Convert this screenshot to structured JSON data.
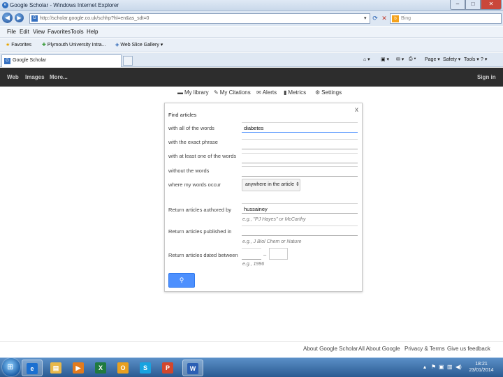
{
  "window": {
    "title": "Google Scholar - Windows Internet Explorer",
    "app_icon": "ie-icon"
  },
  "address_bar": {
    "url": "http://scholar.google.co.uk/schhp?hl=en&as_sdt=0",
    "search_placeholder": "Bing"
  },
  "menu": {
    "items": [
      "File",
      "Edit",
      "View",
      "Favorites",
      "Tools",
      "Help"
    ]
  },
  "favorites": {
    "favorites_label": "Favorites",
    "links": [
      "Plymouth University Intra...",
      "Web Slice Gallery ▾"
    ]
  },
  "tabs": {
    "active_label": "Google Scholar",
    "tools": [
      "Page ▾",
      "Safety ▾",
      "Tools ▾"
    ]
  },
  "google_bar": {
    "links": [
      "Web",
      "Images",
      "More..."
    ],
    "sign_in": "Sign in"
  },
  "scholar_nav": {
    "items": [
      "My library",
      "My Citations",
      "Alerts",
      "Metrics",
      "Settings"
    ]
  },
  "advanced_search": {
    "heading": "Find articles",
    "close": "x",
    "fields": {
      "all_words_label": "with all of the words",
      "all_words_value": "diabetes",
      "exact_phrase_label": "with the exact phrase",
      "at_least_one_label": "with at least one of the words",
      "without_label": "without the words",
      "where_label": "where my words occur",
      "where_value": "anywhere in the article",
      "author_label": "Return articles authored by",
      "author_value": "hussainey",
      "author_hint": "e.g., \"PJ Hayes\" or McCarthy",
      "published_label": "Return articles published in",
      "published_hint": "e.g., J Biol Chem or Nature",
      "dated_label": "Return articles dated between",
      "dated_hint": "e.g., 1996"
    },
    "search_button_icon": "search-icon"
  },
  "footer": {
    "links": [
      "About Google Scholar",
      "All About Google",
      "Privacy & Terms",
      "Give us feedback"
    ]
  },
  "taskbar": {
    "apps": [
      {
        "name": "internet-explorer",
        "glyph": "e",
        "color": "#1b6fd0"
      },
      {
        "name": "file-explorer",
        "glyph": "▤",
        "color": "#e8b84a"
      },
      {
        "name": "media-player",
        "glyph": "▶",
        "color": "#e27b1e"
      },
      {
        "name": "excel",
        "glyph": "X",
        "color": "#1f7a3f"
      },
      {
        "name": "outlook",
        "glyph": "O",
        "color": "#e8a020"
      },
      {
        "name": "skype",
        "glyph": "S",
        "color": "#18a3e0"
      },
      {
        "name": "powerpoint",
        "glyph": "P",
        "color": "#d2472c"
      },
      {
        "name": "word",
        "glyph": "W",
        "color": "#2b5fb4"
      }
    ],
    "clock_time": "18:21",
    "clock_date": "23/01/2014"
  },
  "colors": {
    "google_bar_bg": "#2d2d2d",
    "search_button": "#4d90fe",
    "taskbar": "#2b5b92"
  }
}
